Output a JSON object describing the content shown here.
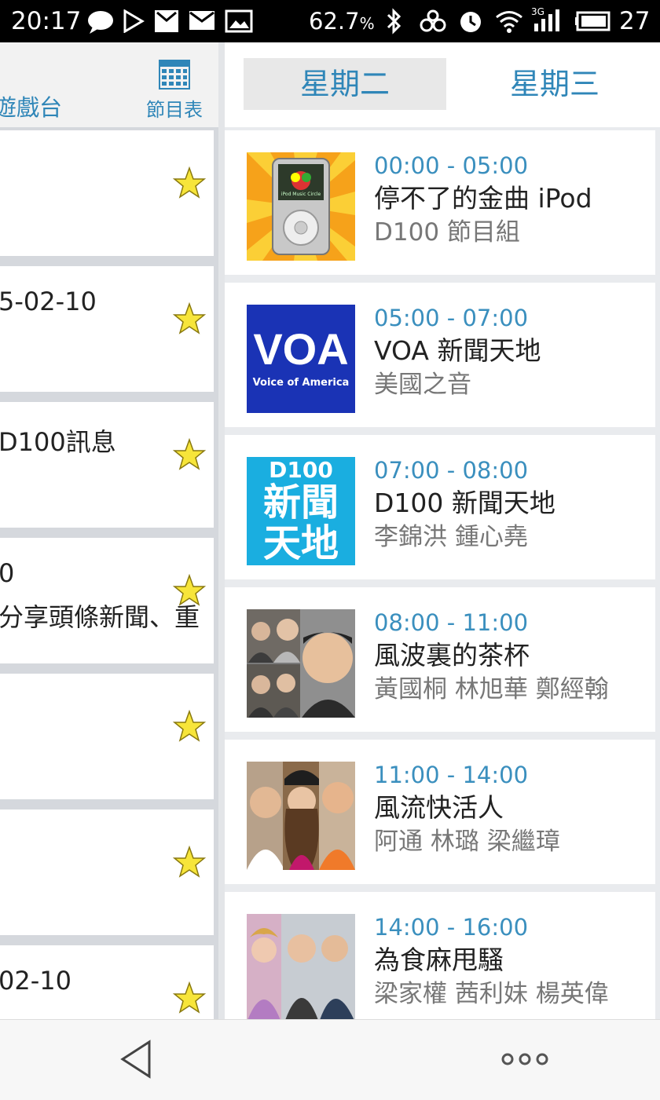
{
  "status_bar": {
    "time": "20:17",
    "battery_percent_text": "62.7",
    "percent_sign": "%",
    "network_type": "3G",
    "battery_level": "27",
    "icons": [
      "chat-bubble-icon",
      "play-store-icon",
      "inbox-icon",
      "mail-icon",
      "gallery-icon",
      "bluetooth-icon",
      "link-icon",
      "alarm-icon",
      "wifi-icon",
      "signal-icon",
      "battery-icon"
    ]
  },
  "left_pane": {
    "channel_label": "遊戲台",
    "schedule_label": "節目表",
    "cards": [
      {
        "line1": "",
        "line2": ""
      },
      {
        "line1": "5-02-10",
        "line2": ""
      },
      {
        "line1": "D100訊息",
        "line2": ""
      },
      {
        "line1": "0",
        "line2": "分享頭條新聞、重"
      },
      {
        "line1": "",
        "line2": ""
      },
      {
        "line1": "",
        "line2": ""
      },
      {
        "line1": "02-10",
        "line2": ""
      }
    ]
  },
  "tabs": {
    "tuesday": "星期二",
    "wednesday": "星期三",
    "selected": "星期二"
  },
  "programs": [
    {
      "time": "00:00 - 05:00",
      "title": "停不了的金曲 iPod",
      "host": "D100 節目組",
      "image": "ipod-thumbnail"
    },
    {
      "time": "05:00 - 07:00",
      "title": "VOA 新聞天地",
      "host": "美國之音",
      "image": "voa-logo"
    },
    {
      "time": "07:00 - 08:00",
      "title": "D100 新聞天地",
      "host": "李錦洪 鍾心堯",
      "image": "d100-news-logo"
    },
    {
      "time": "08:00 - 11:00",
      "title": "風波裏的茶杯",
      "host": "黃國桐 林旭華 鄭經翰",
      "image": "hosts-photo"
    },
    {
      "time": "11:00 - 14:00",
      "title": "風流快活人",
      "host": "阿通 林璐 梁繼璋",
      "image": "hosts-photo"
    },
    {
      "time": "14:00 - 16:00",
      "title": "為食麻甩騷",
      "host": "梁家權 茜利妹 楊英偉",
      "image": "hosts-photo"
    }
  ],
  "thumb_text": {
    "ipod_logo_text": "iPod Music Circle",
    "voa_mark": "VOA",
    "voa_name": "Voice of America",
    "d100_top": "D100",
    "d100_line1": "新聞",
    "d100_line2": "天地"
  },
  "colors": {
    "accent": "#2f86b8",
    "time_text": "#3a8fbe",
    "star": "#f7e53a",
    "voa_blue": "#1a33b5",
    "d100_cyan": "#1aaee0"
  }
}
